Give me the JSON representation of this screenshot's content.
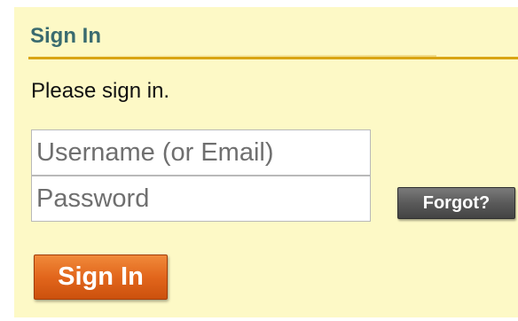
{
  "panel": {
    "title": "Sign In",
    "intro": "Please sign in."
  },
  "form": {
    "username": {
      "value": "",
      "placeholder": "Username (or Email)"
    },
    "password": {
      "value": "",
      "placeholder": "Password"
    },
    "forgot_label": "Forgot?",
    "submit_label": "Sign In"
  },
  "colors": {
    "panel_background": "#fdf9c6",
    "title_text": "#3a6b6f",
    "title_rule": "#d9a514",
    "submit_button": "#e2661c",
    "forgot_button": "#5a5a5a"
  }
}
